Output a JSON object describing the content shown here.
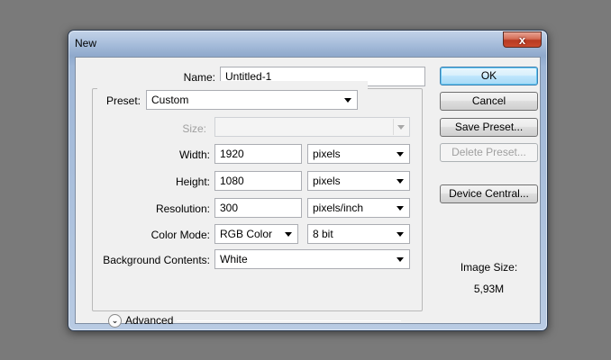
{
  "window": {
    "title": "New",
    "close_glyph": "x"
  },
  "form": {
    "name": {
      "label": "Name:",
      "value": "Untitled-1"
    },
    "preset": {
      "label": "Preset:",
      "value": "Custom"
    },
    "size": {
      "label": "Size:",
      "value": ""
    },
    "width": {
      "label": "Width:",
      "value": "1920",
      "unit": "pixels"
    },
    "height": {
      "label": "Height:",
      "value": "1080",
      "unit": "pixels"
    },
    "resolution": {
      "label": "Resolution:",
      "value": "300",
      "unit": "pixels/inch"
    },
    "color_mode": {
      "label": "Color Mode:",
      "value": "RGB Color",
      "depth": "8 bit"
    },
    "background": {
      "label": "Background Contents:",
      "value": "White"
    },
    "advanced": {
      "label": "Advanced",
      "icon": "chevron-double-down-icon"
    }
  },
  "buttons": {
    "ok": "OK",
    "cancel": "Cancel",
    "save_preset": "Save Preset...",
    "delete_preset": "Delete Preset...",
    "device_central": "Device Central..."
  },
  "image_size": {
    "label": "Image Size:",
    "value": "5,93M"
  }
}
